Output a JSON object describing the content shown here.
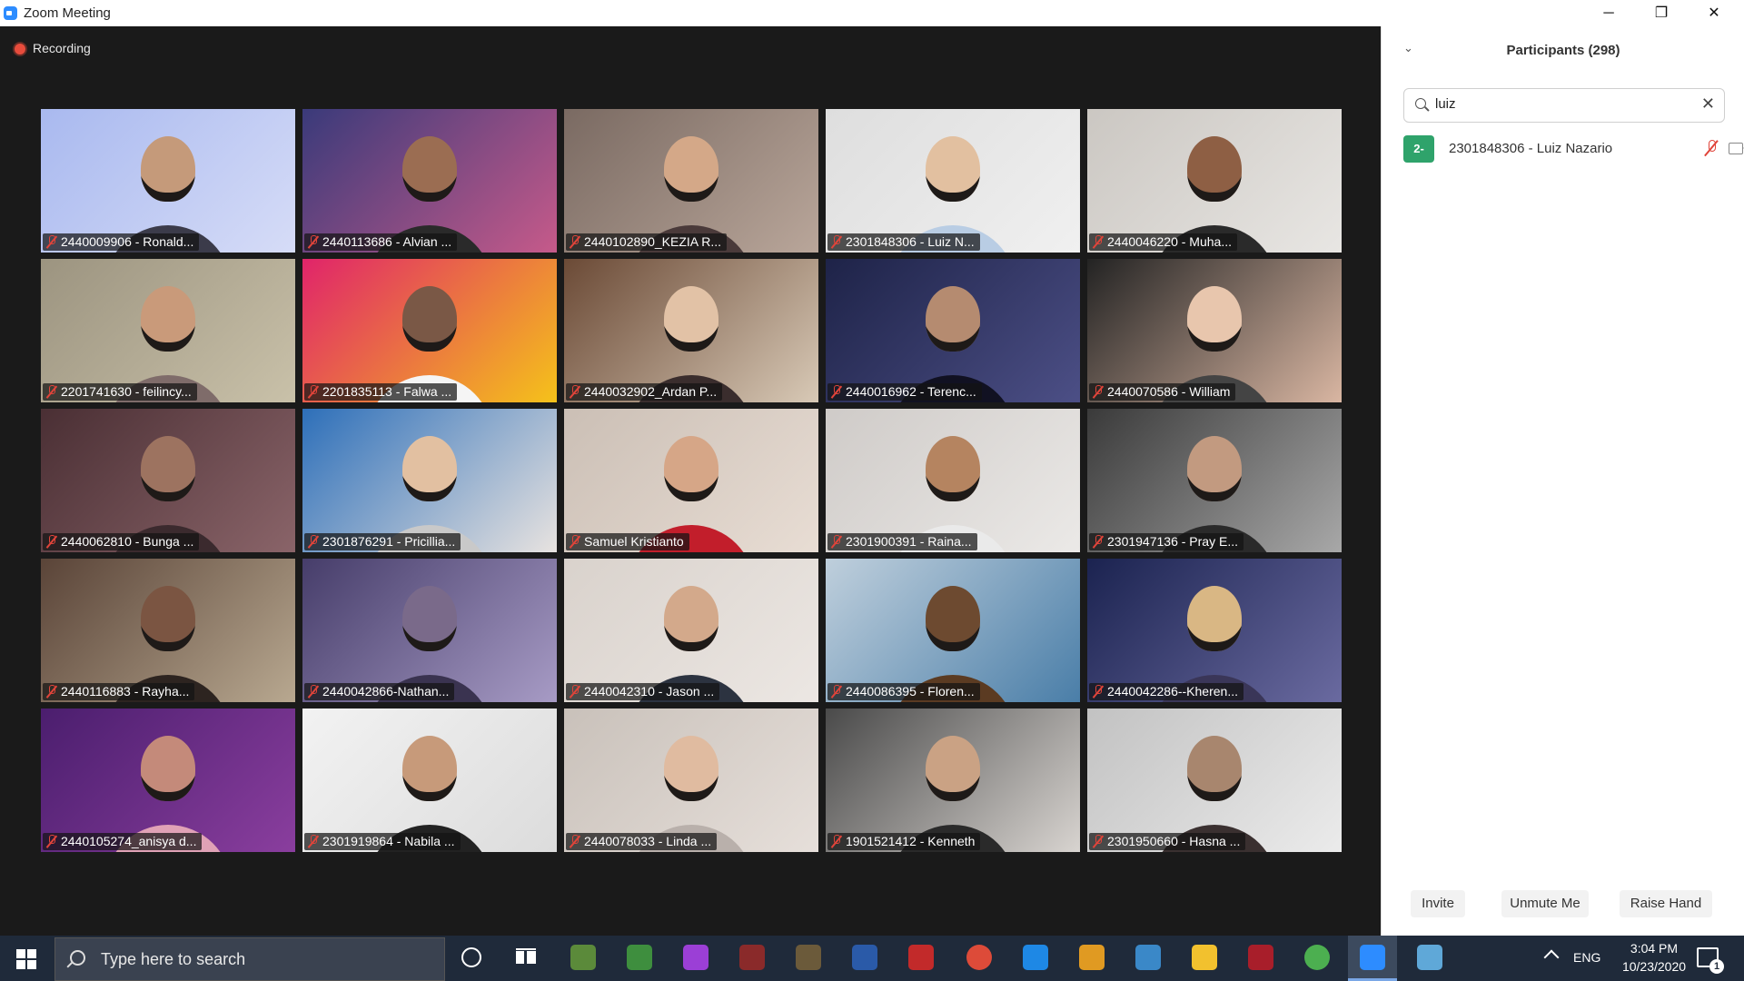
{
  "window": {
    "title": "Zoom Meeting",
    "minimize": "─",
    "restore": "❐",
    "close": "✕"
  },
  "meeting": {
    "recording_label": "Recording",
    "tiles": [
      {
        "name": "2440009906 - Ronald...",
        "bg": "#a9b9ef",
        "bg2": "#d6dcf7",
        "skin": "#c59a7a",
        "shirt": "#3b3b4a"
      },
      {
        "name": "2440113686 - Alvian ...",
        "bg": "#3a3a7a",
        "bg2": "#c65a8a",
        "skin": "#9b6d52",
        "shirt": "#2a2a2a"
      },
      {
        "name": "2440102890_KEZIA R...",
        "bg": "#7a6a62",
        "bg2": "#b9a69a",
        "skin": "#d4a888",
        "shirt": "#4a3a3a"
      },
      {
        "name": "2301848306 - Luiz N...",
        "bg": "#dedede",
        "bg2": "#f0f0f0",
        "skin": "#e2c0a0",
        "shirt": "#b9cde4"
      },
      {
        "name": "2440046220 - Muha...",
        "bg": "#cbc7c2",
        "bg2": "#e8e6e3",
        "skin": "#8e5f44",
        "shirt": "#2a2a2a"
      },
      {
        "name": "2201741630 - feilincy...",
        "bg": "#9c9480",
        "bg2": "#c9c1a9",
        "skin": "#c99a7a",
        "shirt": "#7f6c6a"
      },
      {
        "name": "2201835113 - Falwa ...",
        "bg": "#e0246a",
        "bg2": "#f5c21a",
        "skin": "#7a5846",
        "shirt": "#f5f5f5"
      },
      {
        "name": "2440032902_Ardan P...",
        "bg": "#6b4a36",
        "bg2": "#d8c9b6",
        "skin": "#e2c2a6",
        "shirt": "#3a2d2d"
      },
      {
        "name": "2440016962  - Terenc...",
        "bg": "#1e2348",
        "bg2": "#4c4f86",
        "skin": "#b58b70",
        "shirt": "#111122"
      },
      {
        "name": "2440070586 - William",
        "bg": "#232323",
        "bg2": "#d9b6a2",
        "skin": "#e8c6ad",
        "shirt": "#444444"
      },
      {
        "name": "2440062810 - Bunga ...",
        "bg": "#4a2f34",
        "bg2": "#8a6469",
        "skin": "#9d7360",
        "shirt": "#3b2a2e"
      },
      {
        "name": "2301876291 - Pricillia...",
        "bg": "#2d6fb9",
        "bg2": "#e8e3e0",
        "skin": "#e2c0a1",
        "shirt": "#c9c9c9"
      },
      {
        "name": "Samuel Kristianto",
        "bg": "#cbbfb5",
        "bg2": "#e8ddd4",
        "skin": "#d6a687",
        "shirt": "#c21e2b"
      },
      {
        "name": "2301900391 - Raina...",
        "bg": "#cfcbc8",
        "bg2": "#ebe9e7",
        "skin": "#b58460",
        "shirt": "#eaeaea"
      },
      {
        "name": "2301947136 - Pray E...",
        "bg": "#3a3a3a",
        "bg2": "#a8a8a8",
        "skin": "#c29a80",
        "shirt": "#2a2a2a"
      },
      {
        "name": "2440116883 - Rayha...",
        "bg": "#5a4438",
        "bg2": "#b8a890",
        "skin": "#7b5542",
        "shirt": "#2d2420"
      },
      {
        "name": "2440042866-Nathan...",
        "bg": "#463d6a",
        "bg2": "#a79bc5",
        "skin": "#7a6a8a",
        "shirt": "#3a3350"
      },
      {
        "name": "2440042310 - Jason ...",
        "bg": "#d9d2cc",
        "bg2": "#ece7e3",
        "skin": "#d3a98b",
        "shirt": "#2c3340"
      },
      {
        "name": "2440086395 - Floren...",
        "bg": "#bfcfdc",
        "bg2": "#4a7ea8",
        "skin": "#6d4a30",
        "shirt": "#5b3b22"
      },
      {
        "name": "2440042286--Kheren...",
        "bg": "#1b2350",
        "bg2": "#6a6aa0",
        "skin": "#d9b784",
        "shirt": "#3a3658"
      },
      {
        "name": "2440105274_anisya d...",
        "bg": "#4b1e6e",
        "bg2": "#8a3e9e",
        "skin": "#c48a7a",
        "shirt": "#e0a2b6"
      },
      {
        "name": "2301919864 - Nabila ...",
        "bg": "#f2f2f2",
        "bg2": "#dcdcdc",
        "skin": "#c79a7a",
        "shirt": "#222222"
      },
      {
        "name": "2440078033 - Linda ...",
        "bg": "#c9c1ba",
        "bg2": "#e6dfda",
        "skin": "#e0bba0",
        "shirt": "#b9b0ab"
      },
      {
        "name": "1901521412 - Kenneth",
        "bg": "#4a4a4a",
        "bg2": "#d8d4d0",
        "skin": "#caa284",
        "shirt": "#2a2a2a"
      },
      {
        "name": "2301950660 - Hasna ...",
        "bg": "#c2c2c2",
        "bg2": "#ebebeb",
        "skin": "#a8866e",
        "shirt": "#3a3030"
      }
    ]
  },
  "participants_panel": {
    "title": "Participants (298)",
    "collapse_icon": "⌄",
    "search": {
      "value": "luiz",
      "clear": "✕"
    },
    "results": [
      {
        "avatar": "2-",
        "name": "2301848306 - Luiz Nazario"
      }
    ],
    "buttons": {
      "invite": "Invite",
      "unmute": "Unmute Me",
      "raise_hand": "Raise Hand"
    }
  },
  "taskbar": {
    "search_placeholder": "Type here to search",
    "language": "ENG",
    "time": "3:04 PM",
    "date": "10/23/2020",
    "notification_count": "1",
    "apps": [
      {
        "icon": "minecraft-icon",
        "color": "#5b8a3a"
      },
      {
        "icon": "spreadsheet-icon",
        "color": "#3e8e3e"
      },
      {
        "icon": "emoji-app-icon",
        "color": "#9b3fd6"
      },
      {
        "icon": "game-crest-icon",
        "color": "#8a2a2a"
      },
      {
        "icon": "globe-game-icon",
        "color": "#6b5a3a"
      },
      {
        "icon": "scrivener-icon",
        "color": "#2a5aa8"
      },
      {
        "icon": "mushroom-game-icon",
        "color": "#c22a2a"
      },
      {
        "icon": "chrome-icon",
        "color": "#dd4b39"
      },
      {
        "icon": "vscode-icon",
        "color": "#1e88e5"
      },
      {
        "icon": "runner-game-icon",
        "color": "#e09a22"
      },
      {
        "icon": "file-sync-icon",
        "color": "#3a88c8"
      },
      {
        "icon": "file-explorer-icon",
        "color": "#f2c12e"
      },
      {
        "icon": "red-app-icon",
        "color": "#a81e2a"
      },
      {
        "icon": "utorrent-icon",
        "color": "#4caf50"
      },
      {
        "icon": "zoom-icon",
        "color": "#2D8CFF"
      },
      {
        "icon": "paint-icon",
        "color": "#5fa8d8"
      }
    ]
  }
}
